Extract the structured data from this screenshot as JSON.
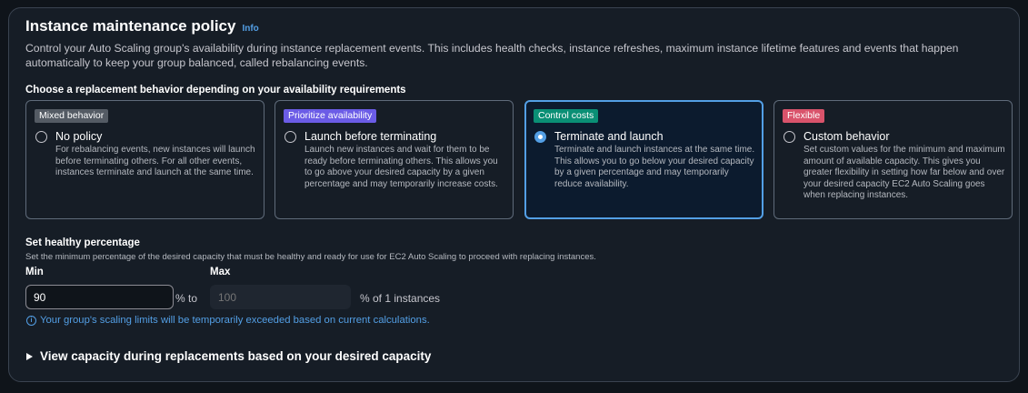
{
  "section": {
    "title": "Instance maintenance policy",
    "info_link": "Info",
    "description": "Control your Auto Scaling group's availability during instance replacement events. This includes health checks, instance refreshes, maximum instance lifetime features and events that happen automatically to keep your group balanced, called rebalancing events."
  },
  "replacement": {
    "label": "Choose a replacement behavior depending on your availability requirements",
    "selected": "Terminate and launch",
    "options": [
      {
        "badge": "Mixed behavior",
        "badge_color": "#545b64",
        "title": "No policy",
        "description": "For rebalancing events, new instances will launch before terminating others. For all other events, instances terminate and launch at the same time."
      },
      {
        "badge": "Prioritize availability",
        "badge_color": "#6b5ce6",
        "title": "Launch before terminating",
        "description": "Launch new instances and wait for them to be ready before terminating others. This allows you to go above your desired capacity by a given percentage and may temporarily increase costs."
      },
      {
        "badge": "Control costs",
        "badge_color": "#0a8f75",
        "title": "Terminate and launch",
        "description": "Terminate and launch instances at the same time. This allows you to go below your desired capacity by a given percentage and may temporarily reduce availability."
      },
      {
        "badge": "Flexible",
        "badge_color": "#d9536b",
        "title": "Custom behavior",
        "description": "Set custom values for the minimum and maximum amount of available capacity. This gives you greater flexibility in setting how far below and over your desired capacity EC2 Auto Scaling goes when replacing instances."
      }
    ]
  },
  "healthy": {
    "title": "Set healthy percentage",
    "description": "Set the minimum percentage of the desired capacity that must be healthy and ready for use for EC2 Auto Scaling to proceed with replacing instances.",
    "min_label": "Min",
    "min_value": "90",
    "to_text": "% to",
    "max_label": "Max",
    "max_placeholder": "100",
    "of_text": "% of 1 instances",
    "info_message": "Your group's scaling limits will be temporarily exceeded based on current calculations."
  },
  "expander": {
    "label": "View capacity during replacements based on your desired capacity"
  },
  "colors": {
    "accent": "#539fe5",
    "panel_bg": "#161d26",
    "page_bg": "#0f141a"
  }
}
